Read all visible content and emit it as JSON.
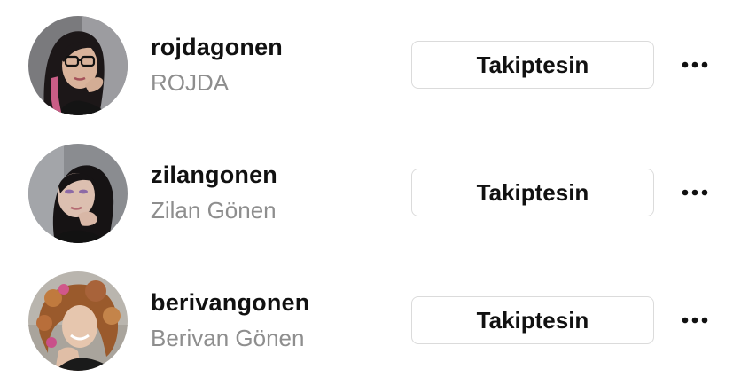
{
  "colors": {
    "primary_text": "#111111",
    "secondary_text": "#8e8e8e",
    "button_border": "#dbdbdb",
    "background": "#ffffff"
  },
  "users": [
    {
      "username": "rojdagonen",
      "full_name": "ROJDA",
      "button_label": "Takiptesin",
      "more_icon": "more-horizontal-icon"
    },
    {
      "username": "zilangonen",
      "full_name": "Zilan Gönen",
      "button_label": "Takiptesin",
      "more_icon": "more-horizontal-icon"
    },
    {
      "username": "berivangonen",
      "full_name": "Berivan Gönen",
      "button_label": "Takiptesin",
      "more_icon": "more-horizontal-icon"
    }
  ]
}
